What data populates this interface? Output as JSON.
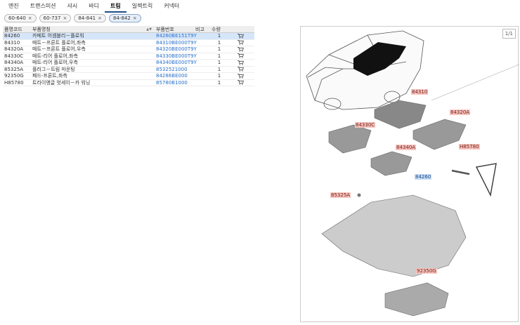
{
  "tabs": [
    {
      "label": "엔진",
      "active": false
    },
    {
      "label": "트랜스미션",
      "active": false
    },
    {
      "label": "샤시",
      "active": false
    },
    {
      "label": "바디",
      "active": false
    },
    {
      "label": "트림",
      "active": true
    },
    {
      "label": "일렉트릭",
      "active": false
    },
    {
      "label": "커넥터",
      "active": false
    }
  ],
  "chips": [
    {
      "label": "60-640",
      "selected": false
    },
    {
      "label": "60-737",
      "selected": false
    },
    {
      "label": "84-841",
      "selected": false
    },
    {
      "label": "84-842",
      "selected": true
    }
  ],
  "chip_close": "×",
  "table": {
    "headers": {
      "code": "품명코드",
      "name": "부품명칭",
      "partno": "부품번호",
      "note": "비고",
      "qty": "수량"
    },
    "rows": [
      {
        "code": "84260",
        "name": "카페트 어셈블리－플로워",
        "partno": "84260BE151T9Y",
        "note": "",
        "qty": "1",
        "selected": true
      },
      {
        "code": "84310",
        "name": "매트－프론트 플로어,좌측",
        "partno": "84310BE000T9Y",
        "note": "",
        "qty": "1",
        "selected": false
      },
      {
        "code": "84320A",
        "name": "매트－프론트 플로어,우측",
        "partno": "84320BE000T9Y",
        "note": "",
        "qty": "1",
        "selected": false
      },
      {
        "code": "84330C",
        "name": "매트-리어 플로어,좌측",
        "partno": "84330BE000T9Y",
        "note": "",
        "qty": "1",
        "selected": false
      },
      {
        "code": "84340A",
        "name": "매트-리어 플로어,우측",
        "partno": "84340BE000T9Y",
        "note": "",
        "qty": "1",
        "selected": false
      },
      {
        "code": "85325A",
        "name": "플러그－트림 마운팅",
        "partno": "8532521000",
        "note": "",
        "qty": "1",
        "selected": false
      },
      {
        "code": "92350G",
        "name": "패드-프론트,좌측",
        "partno": "84286BE000",
        "note": "",
        "qty": "1",
        "selected": false
      },
      {
        "code": "H85780",
        "name": "트라이앵글 엇세이－카 워닝",
        "partno": "85780B1000",
        "note": "",
        "qty": "1",
        "selected": false
      }
    ]
  },
  "diagram": {
    "pager": "1/1",
    "callouts": [
      {
        "label": "84310",
        "highlight": false
      },
      {
        "label": "84320A",
        "highlight": false
      },
      {
        "label": "84330C",
        "highlight": false
      },
      {
        "label": "84340A",
        "highlight": false
      },
      {
        "label": "H85780",
        "highlight": false
      },
      {
        "label": "84260",
        "highlight": true
      },
      {
        "label": "85325A",
        "highlight": false
      },
      {
        "label": "92350G",
        "highlight": false
      }
    ]
  },
  "colors": {
    "accent": "#1f4e8c",
    "link": "#2a6fc9",
    "selected_row": "#d6e6fa",
    "callout_red": "#f4c5c0",
    "callout_blue": "#c9dcf6"
  }
}
